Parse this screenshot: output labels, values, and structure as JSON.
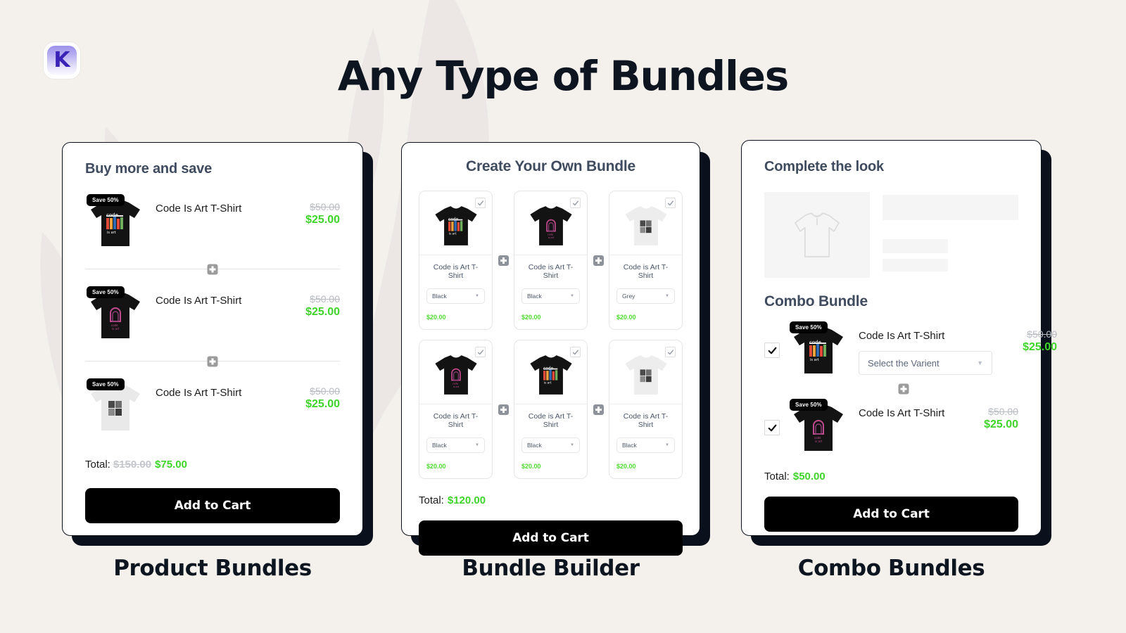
{
  "page": {
    "title": "Any Type of Bundles",
    "logo_letter": "K",
    "background_color": "#f4f0ec",
    "accent_green": "#3fd52a",
    "ink": "#0b111c"
  },
  "cards": [
    {
      "caption": "Product Bundles",
      "heading": "Buy more and save",
      "items": [
        {
          "badge": "Save 50%",
          "name": "Code Is Art T-Shirt",
          "price_old": "$50.00",
          "price_new": "$25.00",
          "art": "code-is-art-color",
          "shirt_color": "#131313"
        },
        {
          "badge": "Save 50%",
          "name": "Code Is Art T-Shirt",
          "price_old": "$50.00",
          "price_new": "$25.00",
          "art": "arch-pink",
          "shirt_color": "#131313"
        },
        {
          "badge": "Save 50%",
          "name": "Code Is Art T-Shirt",
          "price_old": "$50.00",
          "price_new": "$25.00",
          "art": "photo-grid",
          "shirt_color": "#e9e9e9"
        }
      ],
      "total_label": "Total:",
      "total_old": "$150.00",
      "total_new": "$75.00",
      "cta": "Add to Cart"
    },
    {
      "caption": "Bundle Builder",
      "heading": "Create Your Own Bundle",
      "tiles": [
        {
          "name": "Code is Art T-Shirt",
          "variant": "Black",
          "price": "$20.00",
          "checked": true,
          "art": "code-is-art-color",
          "shirt_color": "#131313"
        },
        {
          "name": "Code is Art T-Shirt",
          "variant": "Black",
          "price": "$20.00",
          "checked": true,
          "art": "arch-pink",
          "shirt_color": "#131313"
        },
        {
          "name": "Code is Art T-Shirt",
          "variant": "Grey",
          "price": "$20.00",
          "checked": true,
          "art": "photo-grid",
          "shirt_color": "#ededed"
        },
        {
          "name": "Code is Art T-Shirt",
          "variant": "Black",
          "price": "$20.00",
          "checked": true,
          "art": "arch-pink",
          "shirt_color": "#131313"
        },
        {
          "name": "Code is Art T-Shirt",
          "variant": "Black",
          "price": "$20.00",
          "checked": true,
          "art": "code-is-art-color",
          "shirt_color": "#131313"
        },
        {
          "name": "Code is Art T-Shirt",
          "variant": "Black",
          "price": "$20.00",
          "checked": true,
          "art": "photo-grid",
          "shirt_color": "#ededed"
        }
      ],
      "total_label": "Total:",
      "total_new": "$120.00",
      "cta": "Add to Cart"
    },
    {
      "caption": "Combo Bundles",
      "heading": "Complete the look",
      "combo_title": "Combo Bundle",
      "items": [
        {
          "badge": "Save 50%",
          "name": "Code Is Art T-Shirt",
          "price_old": "$50.00",
          "price_new": "$25.00",
          "checked": true,
          "variant_placeholder": "Select the Varient",
          "art": "code-is-art-color",
          "shirt_color": "#131313"
        },
        {
          "badge": "Save 50%",
          "name": "Code Is Art T-Shirt",
          "price_old": "$50.00",
          "price_new": "$25.00",
          "checked": true,
          "art": "arch-pink",
          "shirt_color": "#131313"
        }
      ],
      "total_label": "Total:",
      "total_new": "$50.00",
      "cta": "Add to Cart"
    }
  ]
}
